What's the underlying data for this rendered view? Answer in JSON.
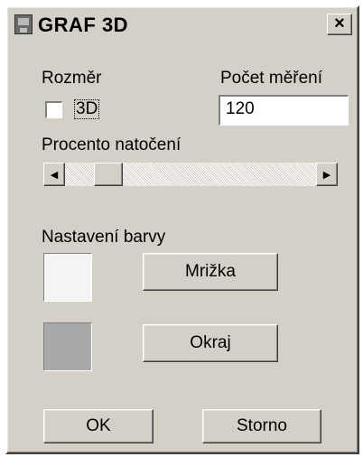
{
  "window": {
    "title": "GRAF 3D",
    "close_label": "×"
  },
  "rozmer": {
    "label": "Rozměr",
    "checkbox_label": "3D",
    "checked": false
  },
  "pocet": {
    "label": "Počet měření",
    "value": "120"
  },
  "natoceni": {
    "label": "Procento natočení",
    "left_arrow": "◀",
    "right_arrow": "▶"
  },
  "barvy": {
    "label": "Nastavení barvy",
    "mrizka_label": "Mrižka",
    "okraj_label": "Okraj",
    "mrizka_color": "#f4f4f4",
    "okraj_color": "#a9a9a9"
  },
  "buttons": {
    "ok": "OK",
    "storno": "Storno"
  }
}
